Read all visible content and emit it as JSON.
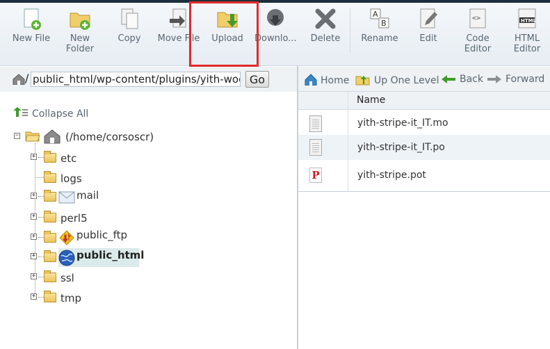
{
  "toolbar": {
    "new_file": "New File",
    "new_folder_1": "New",
    "new_folder_2": "Folder",
    "copy": "Copy",
    "move_file": "Move File",
    "upload": "Upload",
    "download": "Downlo...",
    "delete": "Delete",
    "rename": "Rename",
    "edit": "Edit",
    "code_editor_1": "Code",
    "code_editor_2": "Editor",
    "html_editor_1": "HTML",
    "html_editor_2": "Editor",
    "highlight_color": "#e02a2a"
  },
  "address": {
    "slash": "/",
    "path": "public_html/wp-content/plugins/yith-woocc",
    "go": "Go"
  },
  "tree": {
    "collapse_all": "Collapse All",
    "root": "(/home/corsoscr)",
    "items": [
      {
        "label": "etc"
      },
      {
        "label": "logs"
      },
      {
        "label": "mail"
      },
      {
        "label": "perl5"
      },
      {
        "label": "public_ftp"
      },
      {
        "label": "public_html"
      },
      {
        "label": "ssl"
      },
      {
        "label": "tmp"
      }
    ]
  },
  "nav": {
    "home": "Home",
    "up_one_level": "Up One Level",
    "back": "Back",
    "forward": "Forward"
  },
  "files": {
    "header_name": "Name",
    "rows": [
      {
        "name": "yith-stripe-it_IT.mo"
      },
      {
        "name": "yith-stripe-it_IT.po"
      },
      {
        "name": "yith-stripe.pot"
      }
    ]
  }
}
